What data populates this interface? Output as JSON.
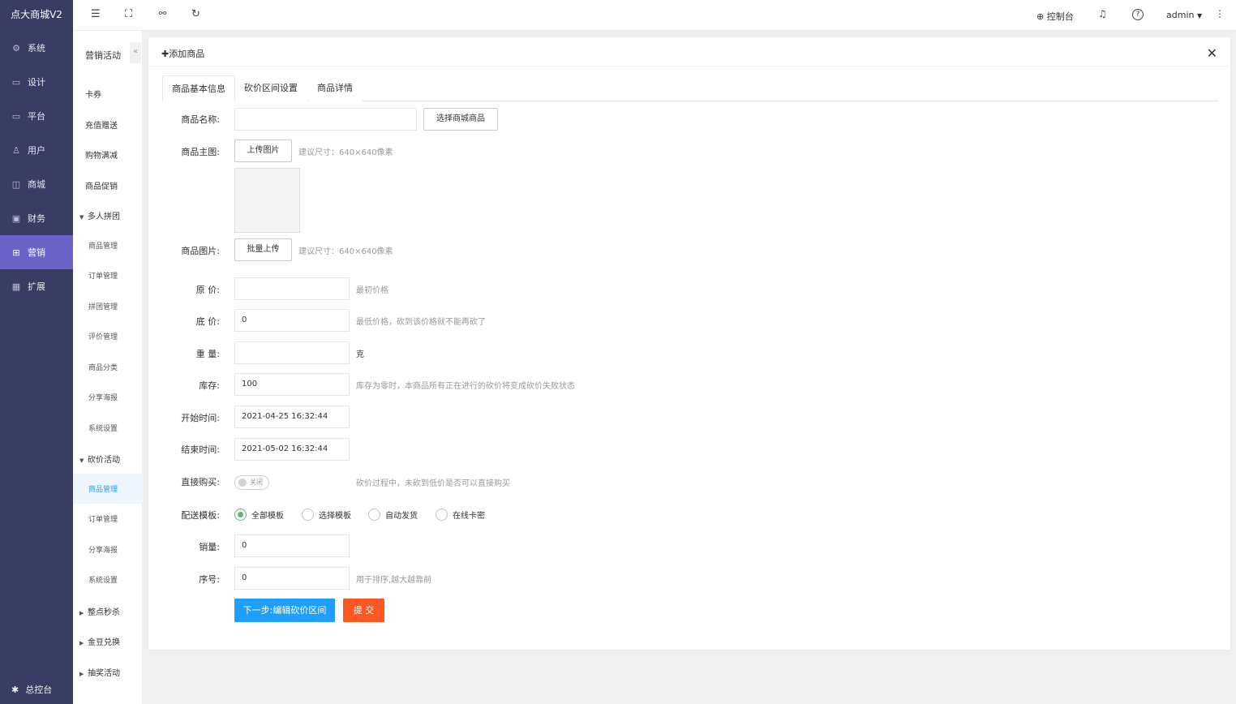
{
  "brand": "点大商城V2",
  "nav": [
    {
      "label": "系统",
      "icon": "gear-icon"
    },
    {
      "label": "设计",
      "icon": "monitor-icon"
    },
    {
      "label": "平台",
      "icon": "platform-icon"
    },
    {
      "label": "用户",
      "icon": "user-icon"
    },
    {
      "label": "商城",
      "icon": "shop-icon"
    },
    {
      "label": "财务",
      "icon": "finance-icon"
    },
    {
      "label": "营销",
      "icon": "gift-icon"
    },
    {
      "label": "扩展",
      "icon": "grid-icon"
    }
  ],
  "nav_active": "营销",
  "console_label": "总控台",
  "submenu": {
    "title": "营销活动",
    "collapse_glyph": "«",
    "items": [
      "卡券",
      "充值赠送",
      "购物满减",
      "商品促销"
    ],
    "group_pintuan": {
      "label": "多人拼团",
      "children": [
        "商品管理",
        "订单管理",
        "拼团管理",
        "评价管理",
        "商品分类",
        "分享海报",
        "系统设置"
      ]
    },
    "group_kanjia": {
      "label": "砍价活动",
      "children": [
        "商品管理",
        "订单管理",
        "分享海报",
        "系统设置"
      ]
    },
    "collapsed_groups": [
      "整点秒杀",
      "金豆兑换",
      "抽奖活动"
    ]
  },
  "topbar": {
    "control_label": "控制台",
    "user": "admin"
  },
  "panel": {
    "title": "添加商品",
    "tabs": [
      "商品基本信息",
      "砍价区间设置",
      "商品详情"
    ]
  },
  "form": {
    "name_label": "商品名称:",
    "name_value": "",
    "select_goods_btn": "选择商城商品",
    "main_img_label": "商品主图:",
    "upload_btn": "上传图片",
    "size_hint": "建议尺寸：640×640像素",
    "pics_label": "商品图片:",
    "batch_upload_btn": "批量上传",
    "orig_price_label": "原 价:",
    "orig_price_value": "",
    "orig_price_hint": "最初价格",
    "floor_price_label": "底 价:",
    "floor_price_value": "0",
    "floor_price_hint": "最低价格，砍到该价格就不能再砍了",
    "weight_label": "重 量:",
    "weight_value": "",
    "weight_unit": "克",
    "stock_label": "库存:",
    "stock_value": "100",
    "stock_hint": "库存为零时，本商品所有正在进行的砍价将变成砍价失败状态",
    "start_label": "开始时间:",
    "start_value": "2021-04-25 16:32:44",
    "end_label": "结束时间:",
    "end_value": "2021-05-02 16:32:44",
    "direct_buy_label": "直接购买:",
    "direct_buy_state": "关闭",
    "direct_buy_hint": "砍价过程中，未砍到低价是否可以直接购买",
    "delivery_label": "配送模板:",
    "delivery_options": [
      "全部模板",
      "选择模板",
      "自动发货",
      "在线卡密"
    ],
    "delivery_selected": "全部模板",
    "sales_label": "销量:",
    "sales_value": "0",
    "order_label": "序号:",
    "order_value": "0",
    "order_hint": "用于排序,越大越靠前",
    "next_btn": "下一步:编辑砍价区间",
    "submit_btn": "提 交"
  }
}
